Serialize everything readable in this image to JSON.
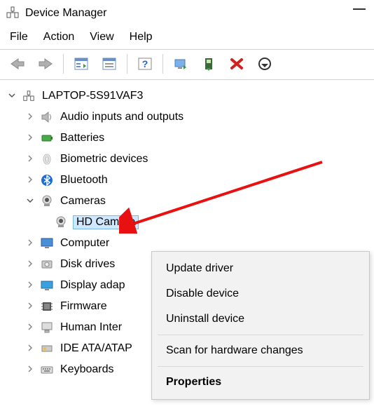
{
  "window": {
    "title": "Device Manager"
  },
  "menu": {
    "file": "File",
    "action": "Action",
    "view": "View",
    "help": "Help"
  },
  "tree": {
    "root": "LAPTOP-5S91VAF3",
    "items": [
      {
        "label": "Audio inputs and outputs"
      },
      {
        "label": "Batteries"
      },
      {
        "label": "Biometric devices"
      },
      {
        "label": "Bluetooth"
      },
      {
        "label": "Cameras",
        "expanded": true
      },
      {
        "label": "HD Camera",
        "selected": true
      },
      {
        "label": "Computer"
      },
      {
        "label": "Disk drives"
      },
      {
        "label": "Display adap"
      },
      {
        "label": "Firmware"
      },
      {
        "label": "Human Inter"
      },
      {
        "label": "IDE ATA/ATAP"
      },
      {
        "label": "Keyboards"
      }
    ]
  },
  "context": {
    "update": "Update driver",
    "disable": "Disable device",
    "uninstall": "Uninstall device",
    "scan": "Scan for hardware changes",
    "properties": "Properties"
  }
}
